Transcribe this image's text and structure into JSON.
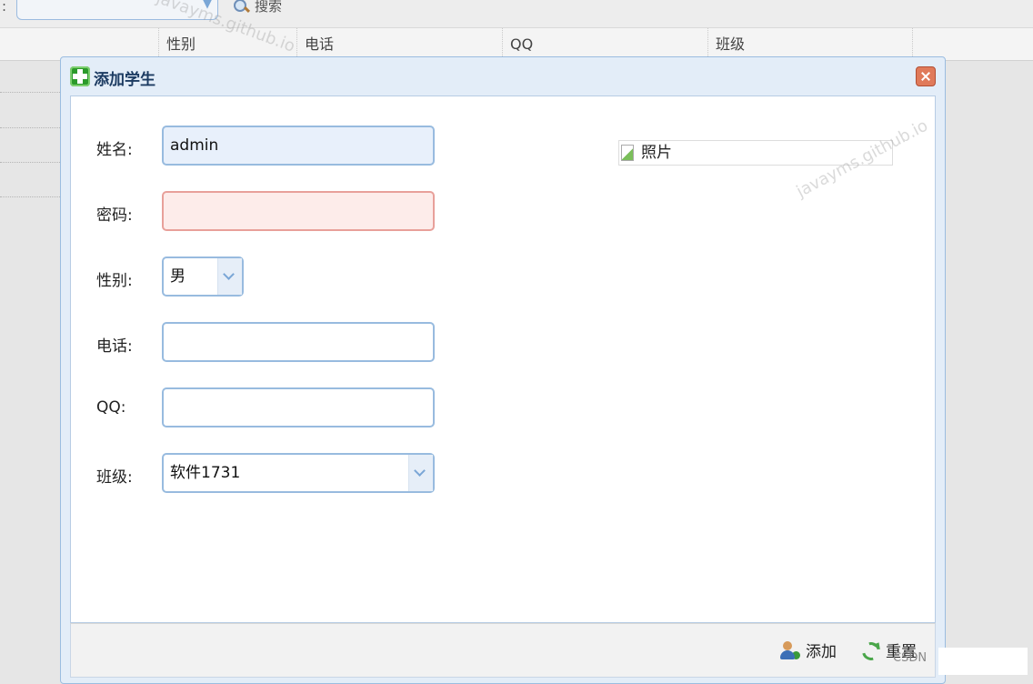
{
  "toolbar": {
    "colon": ":",
    "search_label": "搜索"
  },
  "table": {
    "columns": [
      "性别",
      "电话",
      "QQ",
      "班级"
    ]
  },
  "dialog": {
    "title": "添加学生",
    "fields": {
      "name_label": "姓名:",
      "name_value": "admin",
      "password_label": "密码:",
      "password_value": "",
      "gender_label": "性别:",
      "gender_value": "男",
      "phone_label": "电话:",
      "phone_value": "",
      "qq_label": "QQ:",
      "qq_value": "",
      "class_label": "班级:",
      "class_value": "软件1731"
    },
    "photo_alt": "照片",
    "buttons": {
      "add": "添加",
      "reset": "重置"
    }
  },
  "watermark": "javayms.github.io",
  "badge": "CSDN"
}
